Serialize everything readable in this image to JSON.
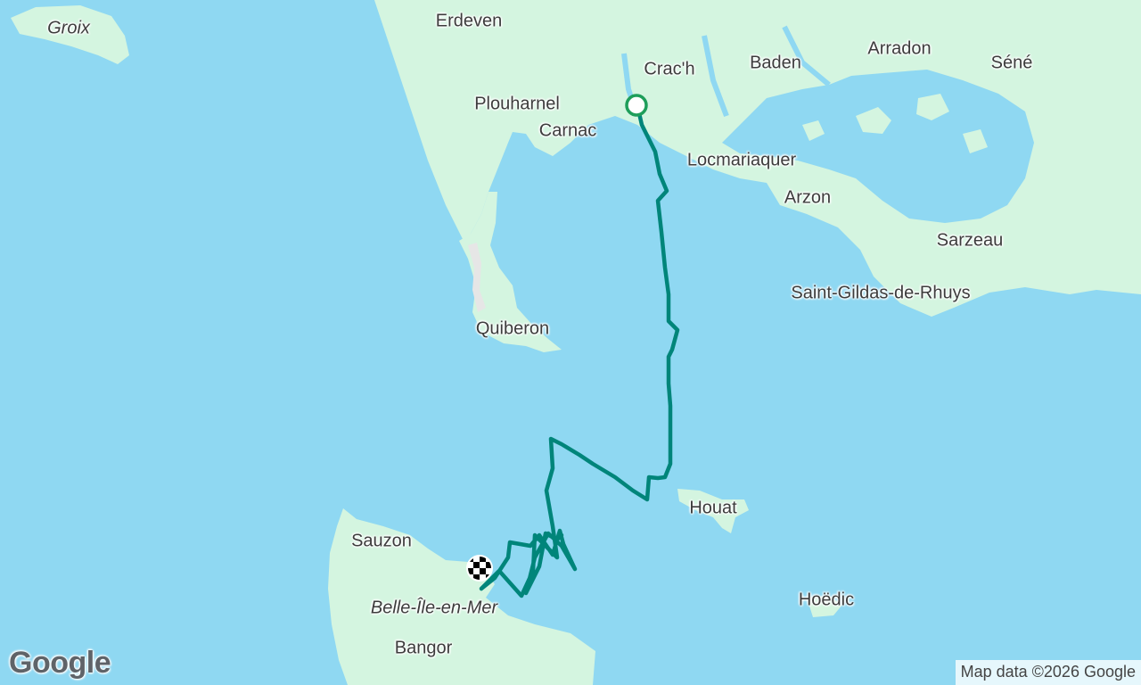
{
  "map": {
    "place_labels": [
      {
        "name": "Groix",
        "italic": true
      },
      {
        "name": "Erdeven",
        "italic": false
      },
      {
        "name": "Crac'h",
        "italic": false
      },
      {
        "name": "Baden",
        "italic": false
      },
      {
        "name": "Arradon",
        "italic": false
      },
      {
        "name": "Séné",
        "italic": false
      },
      {
        "name": "Plouharnel",
        "italic": false
      },
      {
        "name": "Carnac",
        "italic": false
      },
      {
        "name": "Locmariaquer",
        "italic": false
      },
      {
        "name": "Arzon",
        "italic": false
      },
      {
        "name": "Sarzeau",
        "italic": false
      },
      {
        "name": "Saint-Gildas-de-Rhuys",
        "italic": false
      },
      {
        "name": "Quiberon",
        "italic": false
      },
      {
        "name": "Houat",
        "italic": false
      },
      {
        "name": "Sauzon",
        "italic": false
      },
      {
        "name": "Belle-Île-en-Mer",
        "italic": true
      },
      {
        "name": "Bangor",
        "italic": false
      },
      {
        "name": "Hoëdic",
        "italic": false
      }
    ],
    "route_color": "#00857a",
    "start_marker_color": "#1e9e5a",
    "finish_marker": "checkered-flag",
    "colors": {
      "sea": "#8fd8f2",
      "land": "#d4f5e0",
      "land_dark": "#c2ecd0"
    }
  },
  "branding": {
    "logo": "Google",
    "attribution": "Map data ©2026 Google"
  }
}
